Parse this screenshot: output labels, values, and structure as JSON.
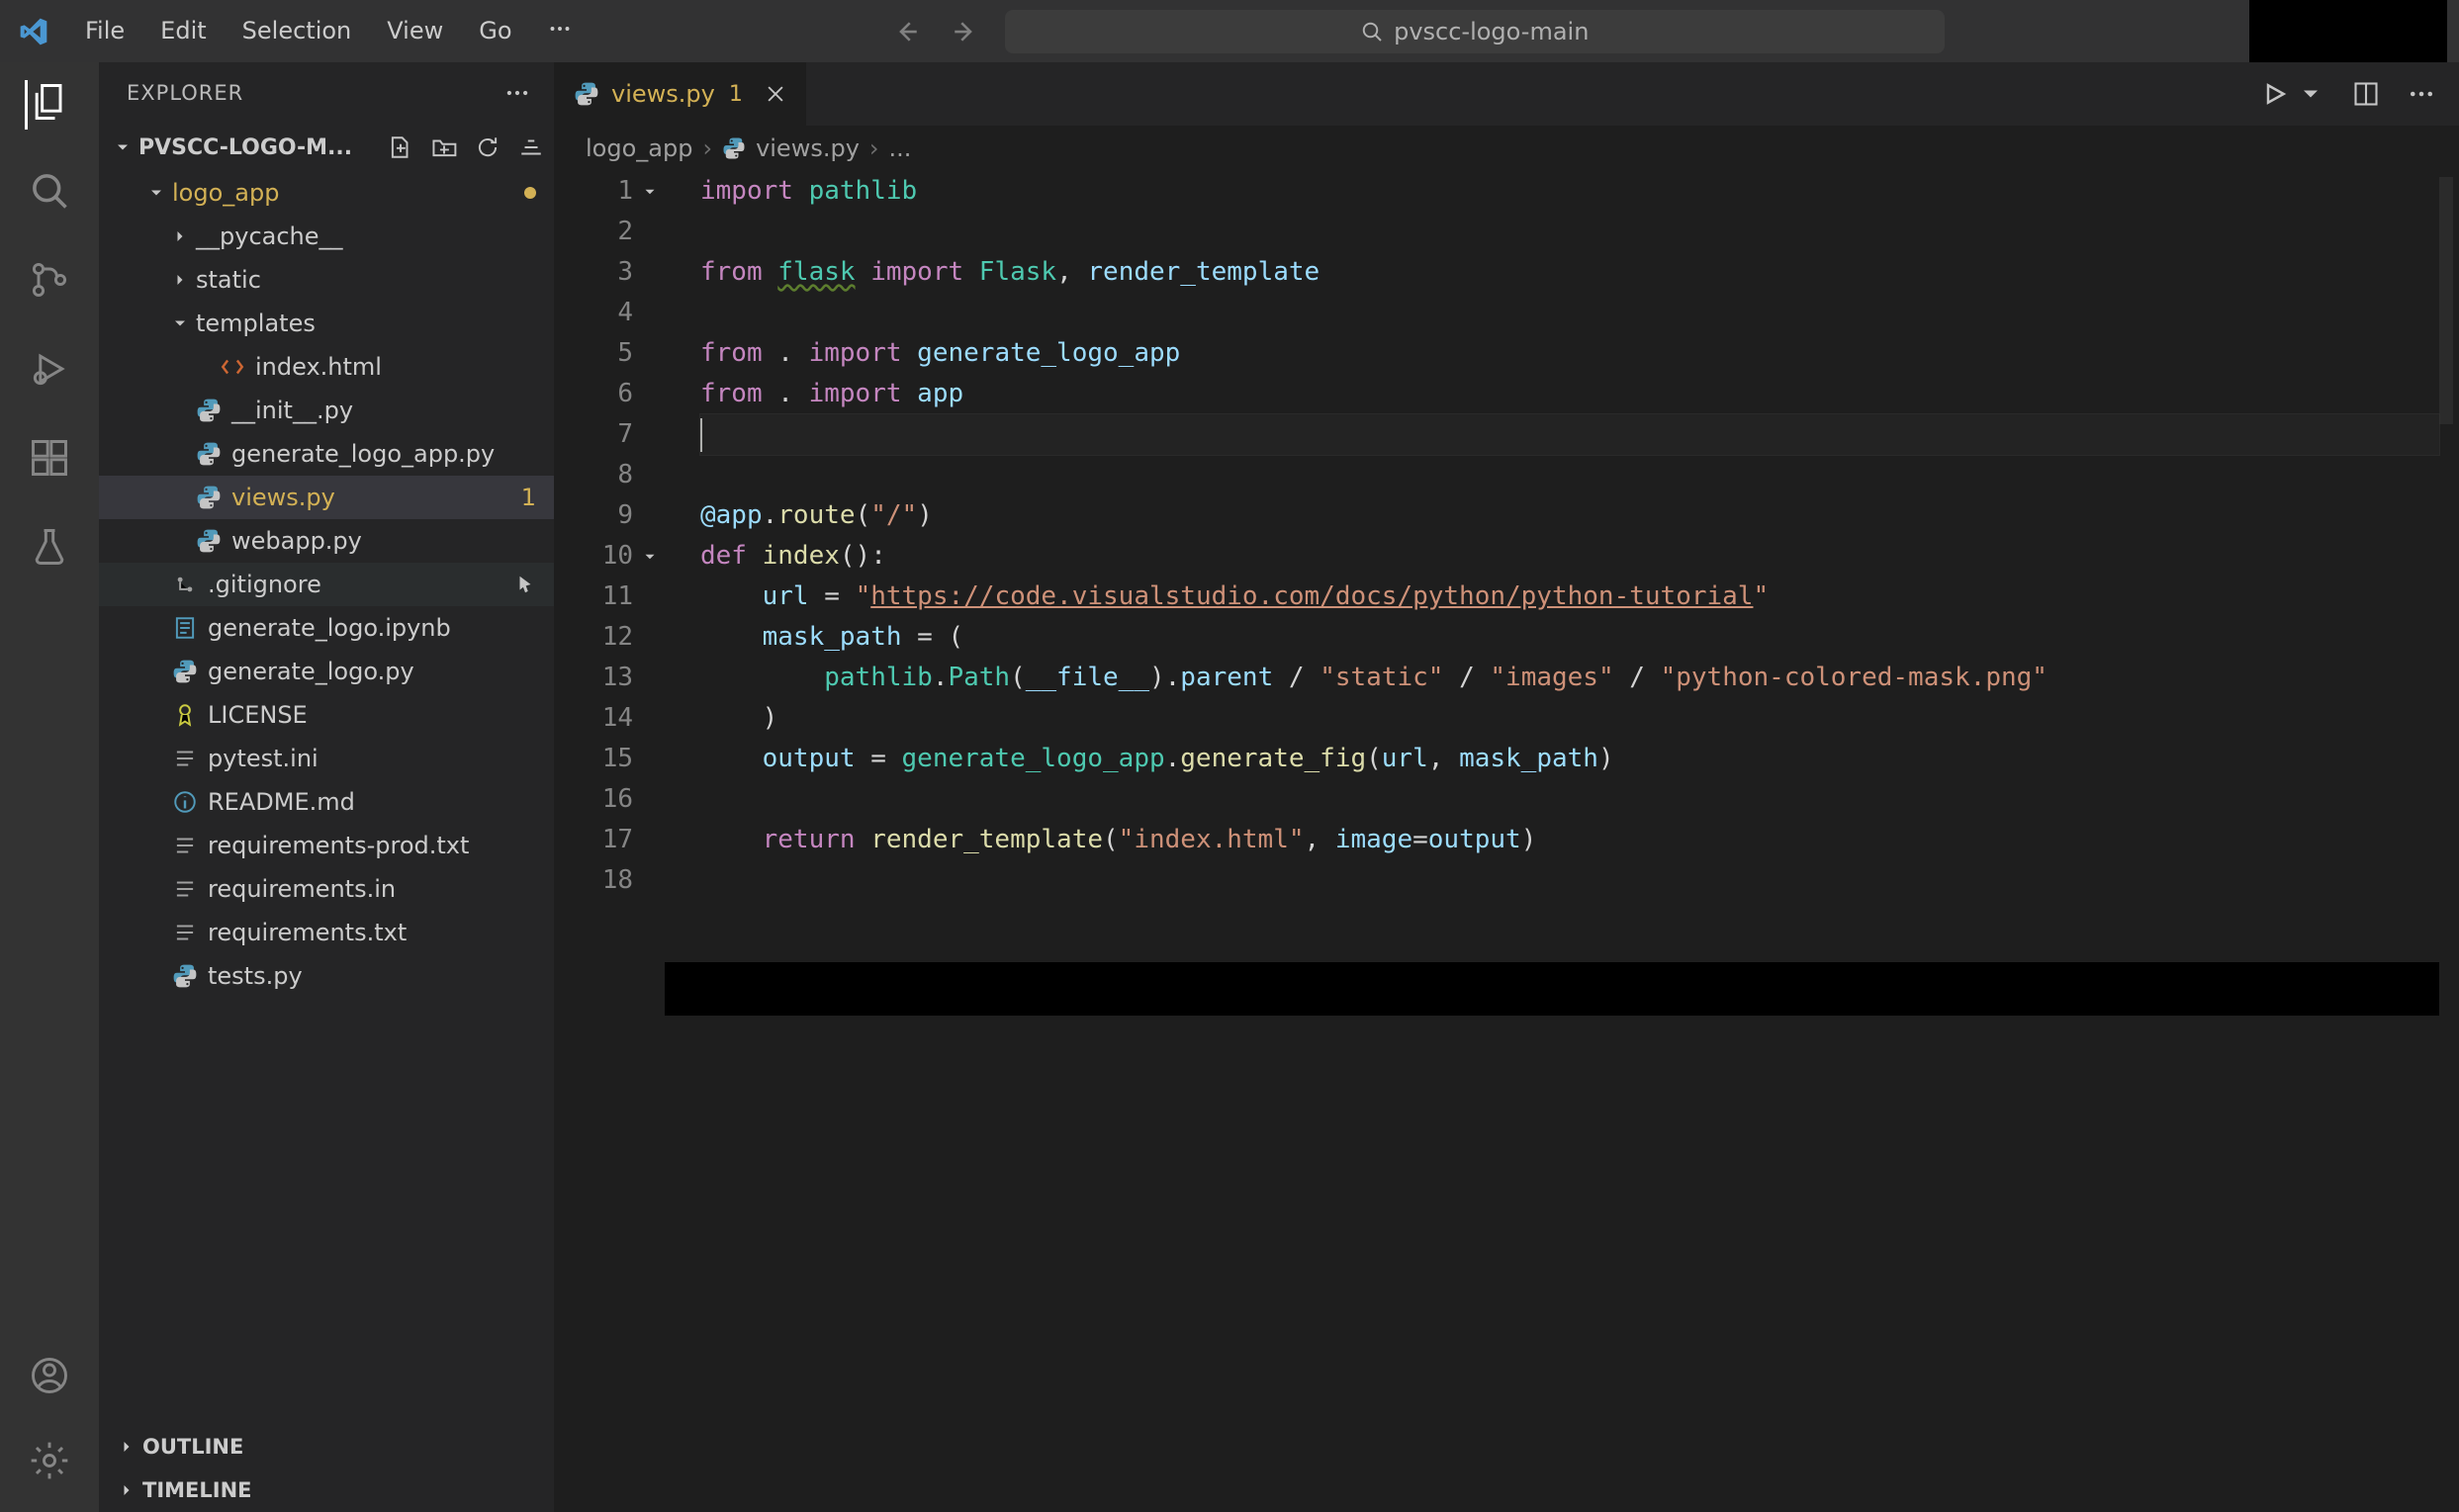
{
  "menubar": {
    "items": [
      "File",
      "Edit",
      "Selection",
      "View",
      "Go"
    ]
  },
  "titlebar": {
    "search_text": "pvscc-logo-main"
  },
  "activity": {
    "items": [
      {
        "name": "explorer",
        "active": true
      },
      {
        "name": "search",
        "active": false
      },
      {
        "name": "source-control",
        "active": false
      },
      {
        "name": "run-debug",
        "active": false
      },
      {
        "name": "extensions",
        "active": false
      },
      {
        "name": "testing",
        "active": false
      }
    ],
    "bottom": [
      {
        "name": "accounts"
      },
      {
        "name": "settings"
      }
    ]
  },
  "sidebar": {
    "title": "EXPLORER",
    "folder_title": "PVSCC-LOGO-M...",
    "sections": {
      "outline": "OUTLINE",
      "timeline": "TIMELINE"
    },
    "tree": [
      {
        "depth": 1,
        "kind": "folder",
        "open": true,
        "label": "logo_app",
        "modified_dot": true,
        "icon": "folder"
      },
      {
        "depth": 2,
        "kind": "folder",
        "open": false,
        "label": "__pycache__",
        "icon": "folder"
      },
      {
        "depth": 2,
        "kind": "folder",
        "open": false,
        "label": "static",
        "icon": "folder"
      },
      {
        "depth": 2,
        "kind": "folder",
        "open": true,
        "label": "templates",
        "icon": "folder"
      },
      {
        "depth": 3,
        "kind": "file",
        "label": "index.html",
        "icon": "html"
      },
      {
        "depth": 2,
        "kind": "file",
        "label": "__init__.py",
        "icon": "python"
      },
      {
        "depth": 2,
        "kind": "file",
        "label": "generate_logo_app.py",
        "icon": "python"
      },
      {
        "depth": 2,
        "kind": "file",
        "label": "views.py",
        "icon": "python",
        "selected": true,
        "modified_count": "1"
      },
      {
        "depth": 2,
        "kind": "file",
        "label": "webapp.py",
        "icon": "python"
      },
      {
        "depth": 1,
        "kind": "file",
        "label": ".gitignore",
        "icon": "git",
        "hovered": true,
        "cursor": true
      },
      {
        "depth": 1,
        "kind": "file",
        "label": "generate_logo.ipynb",
        "icon": "notebook"
      },
      {
        "depth": 1,
        "kind": "file",
        "label": "generate_logo.py",
        "icon": "python"
      },
      {
        "depth": 1,
        "kind": "file",
        "label": "LICENSE",
        "icon": "license"
      },
      {
        "depth": 1,
        "kind": "file",
        "label": "pytest.ini",
        "icon": "ini"
      },
      {
        "depth": 1,
        "kind": "file",
        "label": "README.md",
        "icon": "info"
      },
      {
        "depth": 1,
        "kind": "file",
        "label": "requirements-prod.txt",
        "icon": "txt"
      },
      {
        "depth": 1,
        "kind": "file",
        "label": "requirements.in",
        "icon": "txt"
      },
      {
        "depth": 1,
        "kind": "file",
        "label": "requirements.txt",
        "icon": "txt"
      },
      {
        "depth": 1,
        "kind": "file",
        "label": "tests.py",
        "icon": "python"
      }
    ]
  },
  "editor": {
    "tab": {
      "title": "views.py",
      "badge": "1",
      "icon": "python"
    },
    "breadcrumbs": [
      "logo_app",
      "views.py",
      "..."
    ],
    "line_count": 18,
    "current_line": 7,
    "folds": [
      1,
      10
    ],
    "code": {
      "l1": {
        "kw": "import",
        "mod": "pathlib"
      },
      "l3": {
        "kw1": "from",
        "mod1": "flask",
        "kw2": "import",
        "mod2": "Flask",
        "comma": ", ",
        "var": "render_template"
      },
      "l5": {
        "kw1": "from",
        "dot": " . ",
        "kw2": "import",
        "var": "generate_logo_app"
      },
      "l6": {
        "kw1": "from",
        "dot": " . ",
        "kw2": "import",
        "var": "app"
      },
      "l9": {
        "at": "@app",
        "dot": ".",
        "fn": "route",
        "paren_open": "(",
        "str": "\"/\"",
        "paren_close": ")"
      },
      "l10": {
        "kw": "def",
        "fn": "index",
        "paren": "():"
      },
      "l11": {
        "var": "url",
        "eq": " = ",
        "q": "\"",
        "str": "https://code.visualstudio.com/docs/python/python-tutorial",
        "q2": "\""
      },
      "l12": {
        "var": "mask_path",
        "eq": " = ("
      },
      "l13": {
        "indent": "        ",
        "mod": "pathlib",
        "dot1": ".",
        "cls": "Path",
        "p1": "(",
        "dunder": "__file__",
        "p2": ").",
        "attr": "parent",
        "sep1": " / ",
        "s1": "\"static\"",
        "sep2": " / ",
        "s2": "\"images\"",
        "sep3": " / ",
        "s3": "\"python-colored-mask.png\""
      },
      "l14": {
        "close": "    )"
      },
      "l15": {
        "var": "output",
        "eq": " = ",
        "mod": "generate_logo_app",
        "dot": ".",
        "fn": "generate_fig",
        "p": "(",
        "a1": "url",
        "comma": ", ",
        "a2": "mask_path",
        "p2": ")"
      },
      "l17": {
        "kw": "return",
        "sp": " ",
        "fn": "render_template",
        "p": "(",
        "s": "\"index.html\"",
        "comma": ", ",
        "arg": "image",
        "eq": "=",
        "val": "output",
        "p2": ")"
      }
    }
  }
}
